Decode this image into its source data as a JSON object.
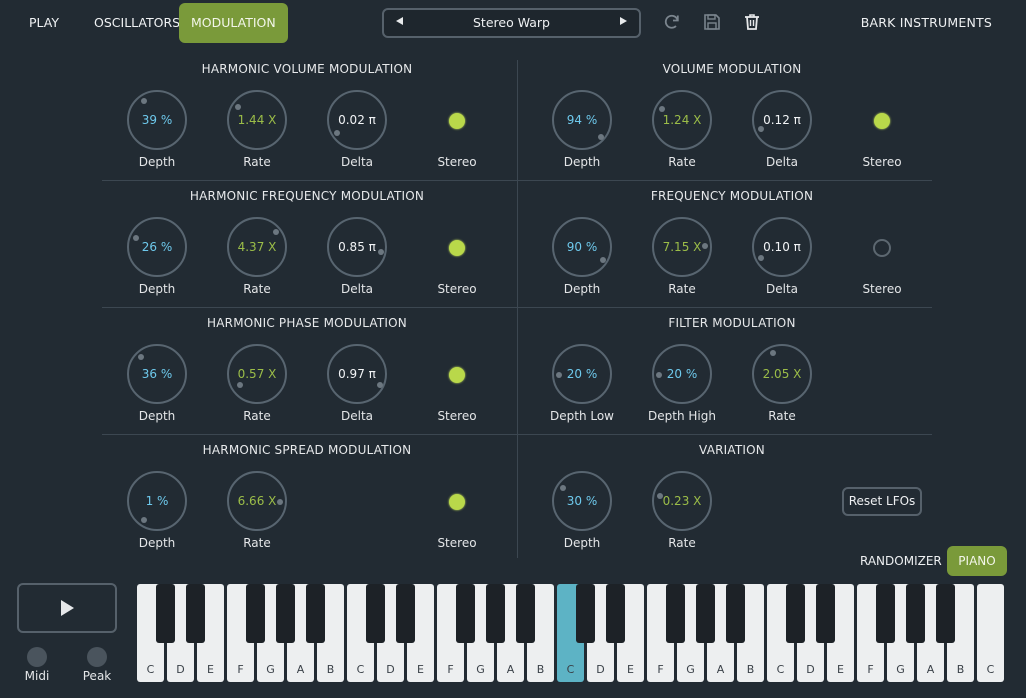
{
  "nav": {
    "play": "PLAY",
    "oscillators": "OSCILLATORS",
    "modulation": "MODULATION"
  },
  "preset": {
    "name": "Stereo Warp",
    "prev_icon": "triangle-left-icon",
    "next_icon": "triangle-right-icon"
  },
  "toolbar_icons": [
    "refresh-icon",
    "save-icon",
    "trash-icon"
  ],
  "brand": "BARK INSTRUMENTS",
  "sections": {
    "harmonic_volume": {
      "title": "HARMONIC VOLUME MODULATION",
      "depth": {
        "value": "39 %",
        "label": "Depth"
      },
      "rate": {
        "value": "1.44 X",
        "label": "Rate"
      },
      "delta": {
        "value": "0.02 π",
        "label": "Delta"
      },
      "stereo": {
        "label": "Stereo",
        "on": true
      }
    },
    "volume": {
      "title": "VOLUME MODULATION",
      "depth": {
        "value": "94 %",
        "label": "Depth"
      },
      "rate": {
        "value": "1.24 X",
        "label": "Rate"
      },
      "delta": {
        "value": "0.12 π",
        "label": "Delta"
      },
      "stereo": {
        "label": "Stereo",
        "on": true
      }
    },
    "harmonic_frequency": {
      "title": "HARMONIC FREQUENCY MODULATION",
      "depth": {
        "value": "26 %",
        "label": "Depth"
      },
      "rate": {
        "value": "4.37 X",
        "label": "Rate"
      },
      "delta": {
        "value": "0.85 π",
        "label": "Delta"
      },
      "stereo": {
        "label": "Stereo",
        "on": true
      }
    },
    "frequency": {
      "title": "FREQUENCY MODULATION",
      "depth": {
        "value": "90 %",
        "label": "Depth"
      },
      "rate": {
        "value": "7.15 X",
        "label": "Rate"
      },
      "delta": {
        "value": "0.10 π",
        "label": "Delta"
      },
      "stereo": {
        "label": "Stereo",
        "on": false
      }
    },
    "harmonic_phase": {
      "title": "HARMONIC PHASE MODULATION",
      "depth": {
        "value": "36 %",
        "label": "Depth"
      },
      "rate": {
        "value": "0.57 X",
        "label": "Rate"
      },
      "delta": {
        "value": "0.97 π",
        "label": "Delta"
      },
      "stereo": {
        "label": "Stereo",
        "on": true
      }
    },
    "filter": {
      "title": "FILTER MODULATION",
      "depth_low": {
        "value": "20 %",
        "label": "Depth Low"
      },
      "depth_high": {
        "value": "20 %",
        "label": "Depth High"
      },
      "rate": {
        "value": "2.05 X",
        "label": "Rate"
      }
    },
    "harmonic_spread": {
      "title": "HARMONIC SPREAD MODULATION",
      "depth": {
        "value": "1 %",
        "label": "Depth"
      },
      "rate": {
        "value": "6.66 X",
        "label": "Rate"
      },
      "stereo": {
        "label": "Stereo",
        "on": true
      }
    },
    "variation": {
      "title": "VARIATION",
      "depth": {
        "value": "30 %",
        "label": "Depth"
      },
      "rate": {
        "value": "0.23 X",
        "label": "Rate"
      }
    }
  },
  "buttons": {
    "reset_lfos": "Reset LFOs",
    "randomizer": "RANDOMIZER",
    "piano": "PIANO"
  },
  "transport": {
    "play_icon": "play-icon",
    "midi_label": "Midi",
    "peak_label": "Peak"
  },
  "keyboard": {
    "white_keys": [
      "C",
      "D",
      "E",
      "F",
      "G",
      "A",
      "B",
      "C",
      "D",
      "E",
      "F",
      "G",
      "A",
      "B",
      "C",
      "D",
      "E",
      "F",
      "G",
      "A",
      "B",
      "C",
      "D",
      "E",
      "F",
      "G",
      "A",
      "B",
      "C"
    ],
    "active_white_key": 14
  },
  "colors": {
    "accent_green": "#7a9a3a",
    "led_on": "#b9d84a",
    "value_cyan": "#6ec9ec",
    "value_green": "#9bbd48",
    "active_key": "#5db3c5"
  }
}
